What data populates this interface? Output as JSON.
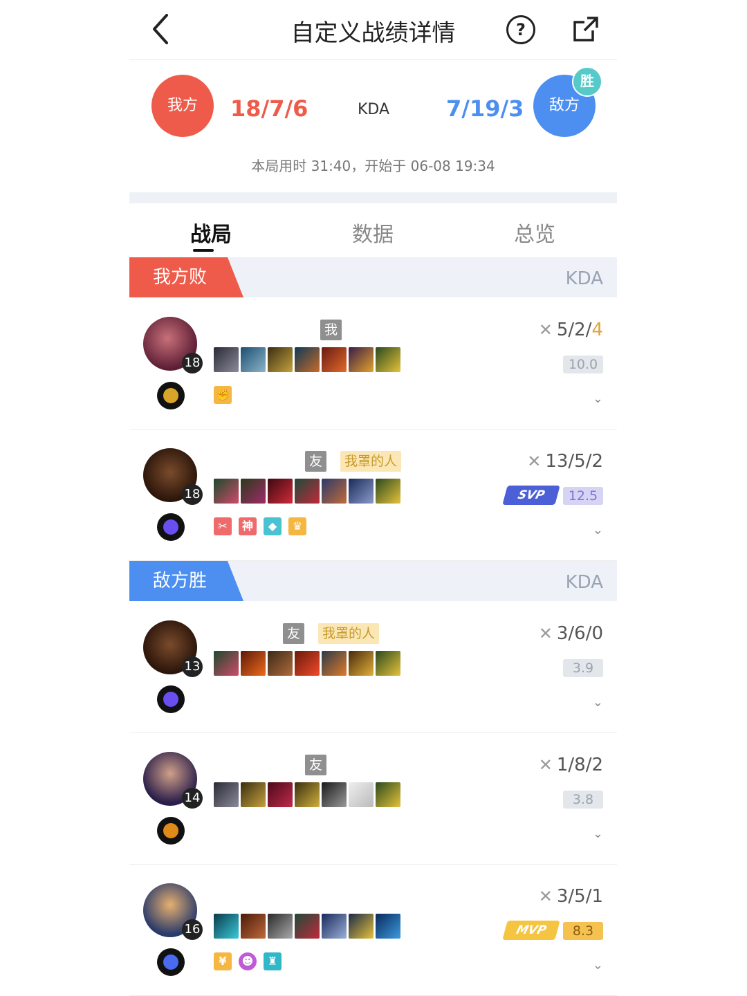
{
  "header": {
    "title": "自定义战绩详情",
    "help_label": "?"
  },
  "score": {
    "my_team_label": "我方",
    "my_kda": "18/7/6",
    "kda_label": "KDA",
    "enemy_kda": "7/19/3",
    "enemy_team_label": "敌方",
    "win_badge": "胜",
    "match_info": "本局用时 31:40，开始于 06-08 19:34"
  },
  "tabs": [
    "战局",
    "数据",
    "总览"
  ],
  "sections": {
    "lose_label": "我方败",
    "win_label": "敌方胜",
    "kda_label": "KDA"
  },
  "players": [
    {
      "tag1": "我",
      "tag2": "",
      "level": "18",
      "kda_a": "5/2/",
      "kda_b": "4",
      "rating": "10.0",
      "award": "",
      "badges": [
        "#f5b742"
      ]
    },
    {
      "tag1": "友",
      "tag2": "我罩的人",
      "level": "18",
      "kda_a": "13/5/2",
      "kda_b": "",
      "rating": "12.5",
      "award": "SVP",
      "badges": [
        "#ef6a6a",
        "#ef6a6a",
        "#49c3d2",
        "#f5b742"
      ]
    },
    {
      "tag1": "友",
      "tag2": "我罩的人",
      "level": "13",
      "kda_a": "3/6/0",
      "kda_b": "",
      "rating": "3.9",
      "award": "",
      "badges": []
    },
    {
      "tag1": "友",
      "tag2": "",
      "level": "14",
      "kda_a": "1/8/2",
      "kda_b": "",
      "rating": "3.8",
      "award": "",
      "badges": []
    },
    {
      "tag1": "",
      "tag2": "",
      "level": "16",
      "kda_a": "3/5/1",
      "kda_b": "",
      "rating": "8.3",
      "award": "MVP",
      "badges": [
        "#f5b742",
        "#c05bd6",
        "#30b8c9"
      ]
    }
  ],
  "colors": {
    "my": "#ef5b4a",
    "enemy": "#4d8ff0"
  }
}
